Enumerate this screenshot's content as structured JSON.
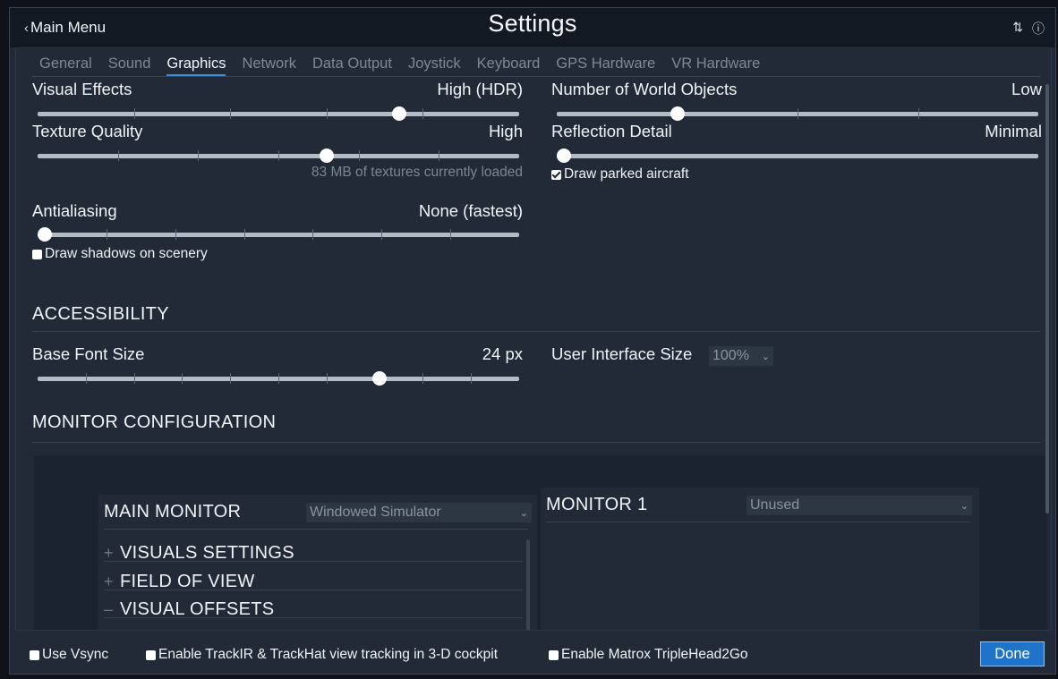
{
  "titlebar": {
    "back_label": "Main Menu",
    "title": "Settings",
    "icons": [
      "sliders-icon",
      "help-icon"
    ]
  },
  "tabs": [
    {
      "label": "General",
      "active": false
    },
    {
      "label": "Sound",
      "active": false
    },
    {
      "label": "Graphics",
      "active": true
    },
    {
      "label": "Network",
      "active": false
    },
    {
      "label": "Data Output",
      "active": false
    },
    {
      "label": "Joystick",
      "active": false
    },
    {
      "label": "Keyboard",
      "active": false
    },
    {
      "label": "GPS Hardware",
      "active": false
    },
    {
      "label": "VR Hardware",
      "active": false
    }
  ],
  "graphics": {
    "visual_effects": {
      "label": "Visual Effects",
      "value": "High (HDR)",
      "level": 0.75
    },
    "texture_quality": {
      "label": "Texture Quality",
      "value": "High",
      "level": 0.6,
      "note": "83 MB of textures currently loaded"
    },
    "antialiasing": {
      "label": "Antialiasing",
      "value": "None (fastest)",
      "level": 0.0
    },
    "draw_shadows": {
      "label": "Draw shadows on scenery",
      "checked": false
    },
    "world_objects": {
      "label": "Number of World Objects",
      "value": "Low",
      "level": 0.25
    },
    "reflection_detail": {
      "label": "Reflection Detail",
      "value": "Minimal",
      "level": 0.0
    },
    "draw_parked": {
      "label": "Draw parked aircraft",
      "checked": true
    }
  },
  "accessibility": {
    "heading": "ACCESSIBILITY",
    "base_font": {
      "label": "Base Font Size",
      "value": "24 px",
      "level": 0.71
    },
    "ui_size": {
      "label": "User Interface Size",
      "value": "100%"
    }
  },
  "monitor_config": {
    "heading": "MONITOR CONFIGURATION",
    "main": {
      "title": "MAIN MONITOR",
      "mode": "Windowed Simulator",
      "sections": [
        {
          "symbol": "+",
          "label": "VISUALS SETTINGS"
        },
        {
          "symbol": "+",
          "label": "FIELD OF VIEW"
        },
        {
          "symbol": "–",
          "label": "VISUAL OFFSETS"
        }
      ]
    },
    "monitor1": {
      "title": "MONITOR 1",
      "mode": "Unused"
    }
  },
  "footer": {
    "vsync": {
      "label": "Use Vsync",
      "checked": false
    },
    "trackir": {
      "label": "Enable TrackIR & TrackHat view tracking in 3-D cockpit",
      "checked": false
    },
    "matrox": {
      "label": "Enable Matrox TripleHead2Go",
      "checked": false
    },
    "done_label": "Done"
  },
  "colors": {
    "accent": "#1f73c9",
    "panel": "#212a36",
    "titlebar": "#131922"
  }
}
